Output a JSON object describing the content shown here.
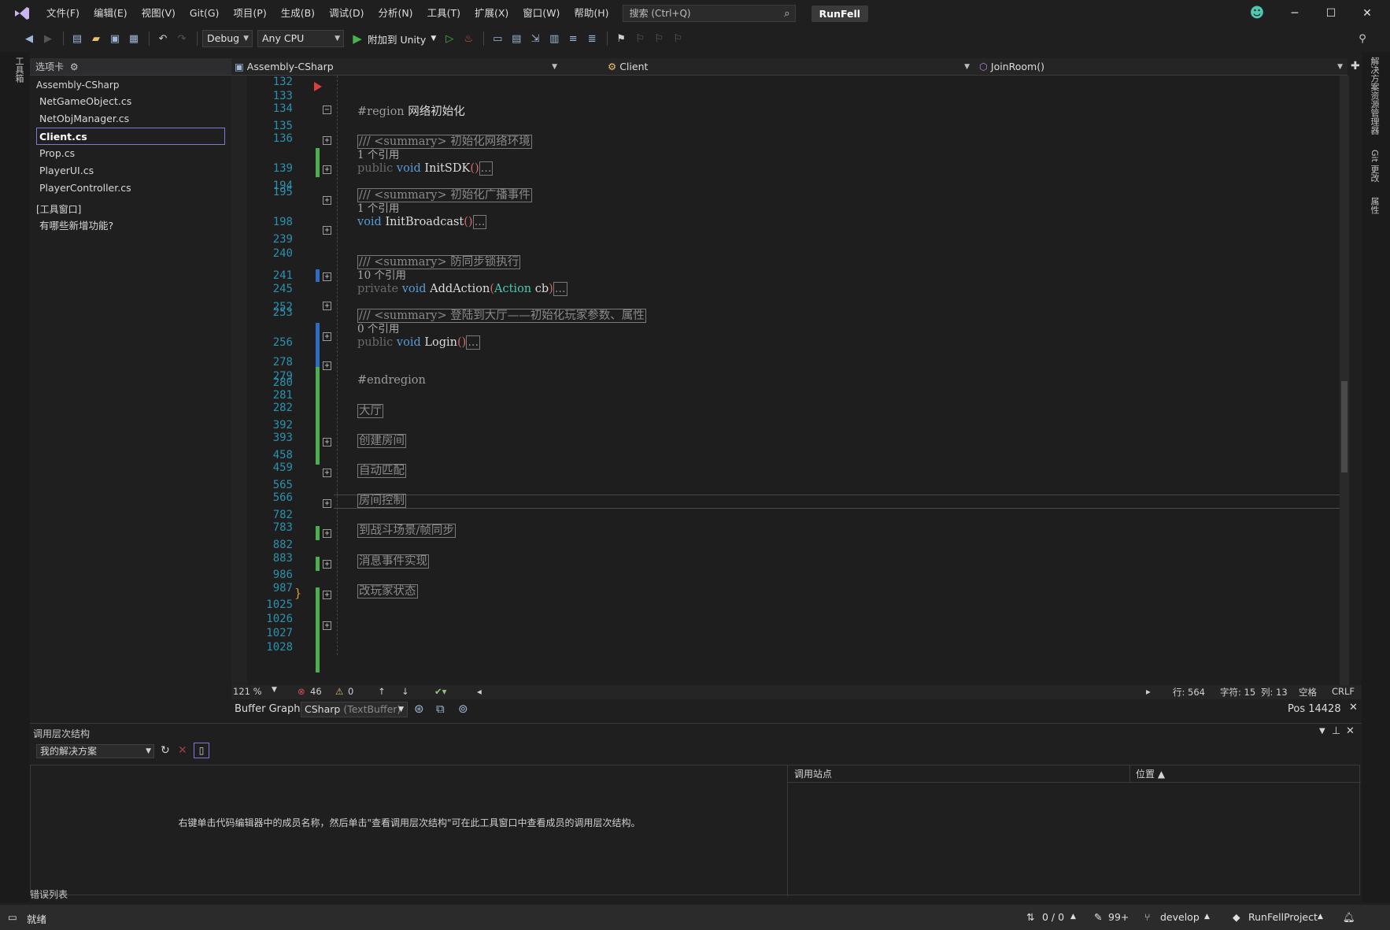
{
  "titlebar": {
    "menus": [
      "文件(F)",
      "编辑(E)",
      "视图(V)",
      "Git(G)",
      "项目(P)",
      "生成(B)",
      "调试(D)",
      "分析(N)",
      "工具(T)",
      "扩展(X)",
      "窗口(W)",
      "帮助(H)"
    ],
    "search_placeholder": "搜索 (Ctrl+Q)",
    "project_name": "RunFell",
    "window_controls": [
      "minimize-icon",
      "maximize-icon",
      "close-icon"
    ]
  },
  "toolbar": {
    "config": "Debug",
    "platform": "Any CPU",
    "attach_label": "附加到 Unity"
  },
  "left_strip": {
    "label": "工具箱"
  },
  "right_strip": {
    "labels": [
      "解决方案资源管理器",
      "Git 更改",
      "属性"
    ]
  },
  "tabs_pane": {
    "header": "选项卡",
    "group": "Assembly-CSharp",
    "files": [
      "NetGameObject.cs",
      "NetObjManager.cs",
      "Client.cs",
      "Prop.cs",
      "PlayerUI.cs",
      "PlayerController.cs"
    ],
    "selected": "Client.cs",
    "tool_group": "[工具窗口]",
    "tool_item": "有哪些新增功能?"
  },
  "navbar": {
    "project": "Assembly-CSharp",
    "class": "Client",
    "member": "JoinRoom()"
  },
  "editor": {
    "lines": [
      {
        "n": "132",
        "text": ""
      },
      {
        "n": "133",
        "text": ""
      },
      {
        "n": "134",
        "text": "#region 网络初始化"
      },
      {
        "n": "135",
        "text": ""
      },
      {
        "n": "136",
        "text": "/// <summary> 初始化网络环境"
      },
      {
        "n": "139",
        "text": "public void InitSDK()..."
      },
      {
        "n": "194",
        "text": ""
      },
      {
        "n": "195",
        "text": "/// <summary> 初始化广播事件"
      },
      {
        "n": "198",
        "text": "void InitBroadcast()..."
      },
      {
        "n": "239",
        "text": ""
      },
      {
        "n": "240",
        "text": ""
      },
      {
        "n": "241",
        "text": "/// <summary> 防同步锁执行"
      },
      {
        "n": "245",
        "text": "private void AddAction(Action cb)..."
      },
      {
        "n": "252",
        "text": ""
      },
      {
        "n": "253",
        "text": "/// <summary> 登陆到大厅——初始化玩家参数、属性"
      },
      {
        "n": "256",
        "text": "public void Login()..."
      },
      {
        "n": "278",
        "text": ""
      },
      {
        "n": "279",
        "text": ""
      },
      {
        "n": "280",
        "text": "#endregion"
      },
      {
        "n": "281",
        "text": ""
      },
      {
        "n": "282",
        "text": "大厅"
      },
      {
        "n": "392",
        "text": ""
      },
      {
        "n": "393",
        "text": "创建房间"
      },
      {
        "n": "458",
        "text": ""
      },
      {
        "n": "459",
        "text": "自动匹配"
      },
      {
        "n": "565",
        "text": ""
      },
      {
        "n": "566",
        "text": "房间控制"
      },
      {
        "n": "782",
        "text": ""
      },
      {
        "n": "783",
        "text": "到战斗场景/帧同步"
      },
      {
        "n": "882",
        "text": ""
      },
      {
        "n": "883",
        "text": "消息事件实现"
      },
      {
        "n": "986",
        "text": ""
      },
      {
        "n": "987",
        "text": "改玩家状态"
      },
      {
        "n": "1025",
        "text": ""
      },
      {
        "n": "1026",
        "text": "}"
      },
      {
        "n": "1027",
        "text": ""
      },
      {
        "n": "1028",
        "text": ""
      }
    ],
    "region_start": "#region",
    "region_name": "网络初始化",
    "region_end": "#endregion",
    "summary_tag": "/// <summary>",
    "summaries": [
      "初始化网络环境",
      "初始化广播事件",
      "防同步锁执行",
      "登陆到大厅——初始化玩家参数、属性"
    ],
    "refs": [
      "1 个引用",
      "1 个引用",
      "10 个引用",
      "0 个引用"
    ],
    "methods": {
      "initsdk": {
        "mod": "public",
        "ret": "void",
        "name": "InitSDK",
        "params": ""
      },
      "initbroadcast": {
        "mod": "",
        "ret": "void",
        "name": "InitBroadcast",
        "params": ""
      },
      "addaction": {
        "mod": "private",
        "ret": "void",
        "name": "AddAction",
        "param_type": "Action",
        "param_name": " cb"
      },
      "login": {
        "mod": "public",
        "ret": "void",
        "name": "Login",
        "params": ""
      }
    },
    "collapsed": "...",
    "regions": [
      "大厅",
      "创建房间",
      "自动匹配",
      "房间控制",
      "到战斗场景/帧同步",
      "消息事件实现",
      "改玩家状态"
    ],
    "close_brace": "}"
  },
  "editor_status": {
    "zoom": "121 %",
    "errors": "46",
    "warnings": "0",
    "line": "行: 564",
    "char": "字符: 15",
    "col": "列: 13",
    "whitespace": "空格",
    "eol": "CRLF"
  },
  "buffer_graph": {
    "label": "Buffer Graph:",
    "value": "CSharp",
    "value_hint": "(TextBuffer)",
    "pos": "Pos 14428"
  },
  "call_hierarchy": {
    "title": "调用层次结构",
    "scope": "我的解决方案",
    "hint": "右键单击代码编辑器中的成员名称，然后单击\"查看调用层次结构\"可在此工具窗口中查看成员的调用层次结构。",
    "col_callsite": "调用站点",
    "col_location": "位置"
  },
  "error_list_tab": "错误列表",
  "statusbar": {
    "ready": "就绪",
    "sync": "0 / 0",
    "edits": "99+",
    "branch": "develop",
    "repo": "RunFellProject"
  }
}
